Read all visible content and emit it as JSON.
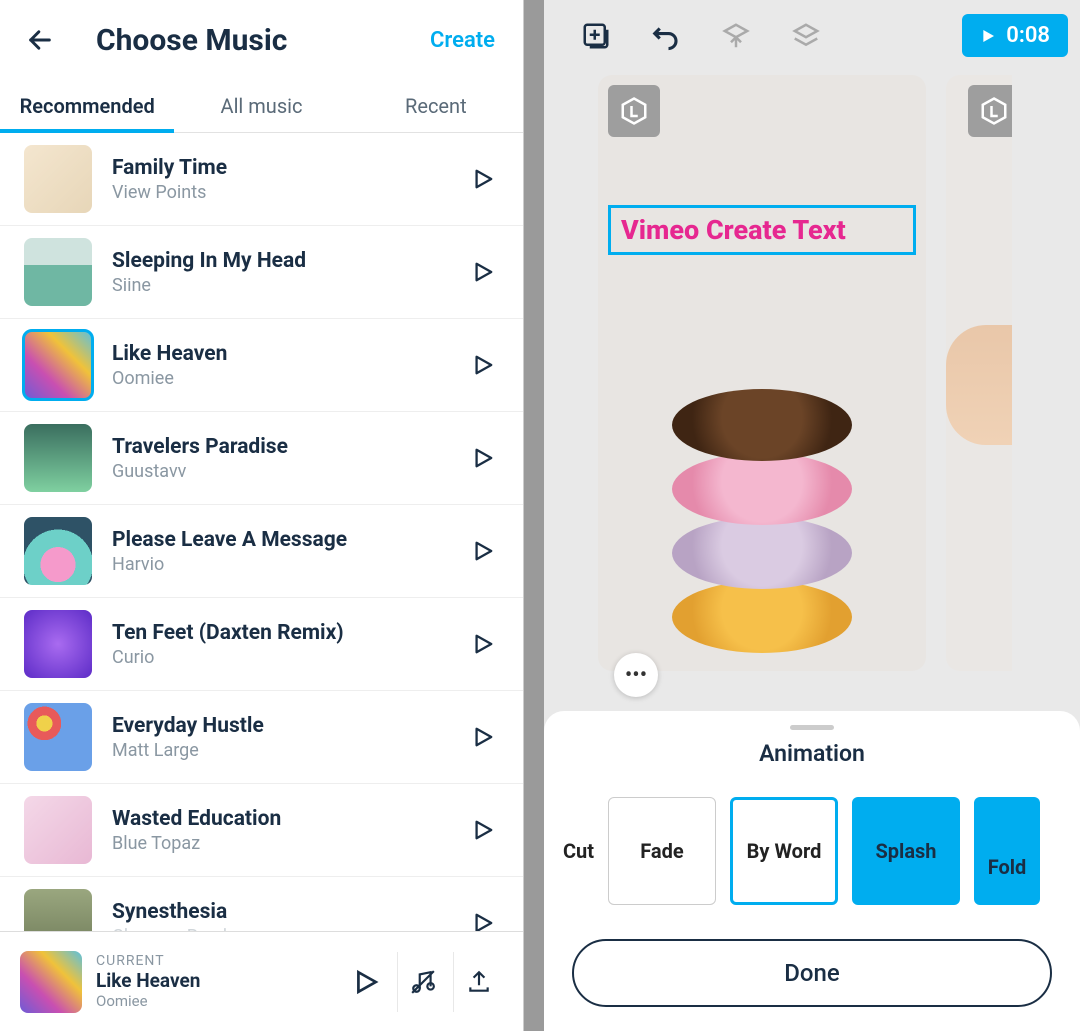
{
  "music": {
    "title": "Choose Music",
    "create_label": "Create",
    "tabs": [
      {
        "label": "Recommended",
        "active": true
      },
      {
        "label": "All music",
        "active": false
      },
      {
        "label": "Recent",
        "active": false
      }
    ],
    "tracks": [
      {
        "title": "Family Time",
        "artist": "View Points",
        "selected": false
      },
      {
        "title": "Sleeping In My Head",
        "artist": "Siine",
        "selected": false
      },
      {
        "title": "Like Heaven",
        "artist": "Oomiee",
        "selected": true
      },
      {
        "title": "Travelers Paradise",
        "artist": "Guustavv",
        "selected": false
      },
      {
        "title": "Please Leave A Message",
        "artist": "Harvio",
        "selected": false
      },
      {
        "title": "Ten Feet (Daxten Remix)",
        "artist": "Curio",
        "selected": false
      },
      {
        "title": "Everyday Hustle",
        "artist": "Matt Large",
        "selected": false
      },
      {
        "title": "Wasted Education",
        "artist": "Blue Topaz",
        "selected": false
      },
      {
        "title": "Synesthesia",
        "artist": "Clarence Reed",
        "selected": false
      }
    ],
    "current": {
      "label": "CURRENT",
      "title": "Like Heaven",
      "artist": "Oomiee"
    }
  },
  "editor": {
    "play_time": "0:08",
    "overlay_text": "Vimeo Create Text",
    "sheet_title": "Animation",
    "animations": [
      {
        "label": "Cut",
        "style": "cut"
      },
      {
        "label": "Fade",
        "style": "plain"
      },
      {
        "label": "By Word",
        "style": "sel"
      },
      {
        "label": "Splash",
        "style": "splash"
      },
      {
        "label": "Fold",
        "style": "fold"
      }
    ],
    "done_label": "Done"
  }
}
